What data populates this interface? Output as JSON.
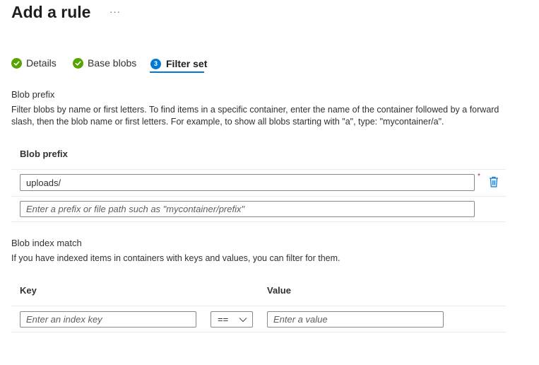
{
  "header": {
    "title": "Add a rule",
    "more_label": "···"
  },
  "tabs": [
    {
      "label": "Details",
      "state": "complete"
    },
    {
      "label": "Base blobs",
      "state": "complete"
    },
    {
      "label": "Filter set",
      "state": "active",
      "step": "3"
    }
  ],
  "blob_prefix": {
    "section_label": "Blob prefix",
    "description": "Filter blobs by name or first letters. To find items in a specific container, enter the name of the container followed by a forward slash, then the blob name or first letters. For example, to show all blobs starting with \"a\", type: \"mycontainer/a\".",
    "column_header": "Blob prefix",
    "rows": [
      {
        "value": "uploads/"
      }
    ],
    "new_row_placeholder": "Enter a prefix or file path such as \"mycontainer/prefix\"",
    "required_marker": "*"
  },
  "blob_index": {
    "section_label": "Blob index match",
    "description": "If you have indexed items in containers with keys and values, you can filter for them.",
    "key_header": "Key",
    "value_header": "Value",
    "key_placeholder": "Enter an index key",
    "operator": "==",
    "value_placeholder": "Enter a value"
  },
  "colors": {
    "accent": "#0078d4",
    "success": "#57a300",
    "required": "#a4262c"
  }
}
